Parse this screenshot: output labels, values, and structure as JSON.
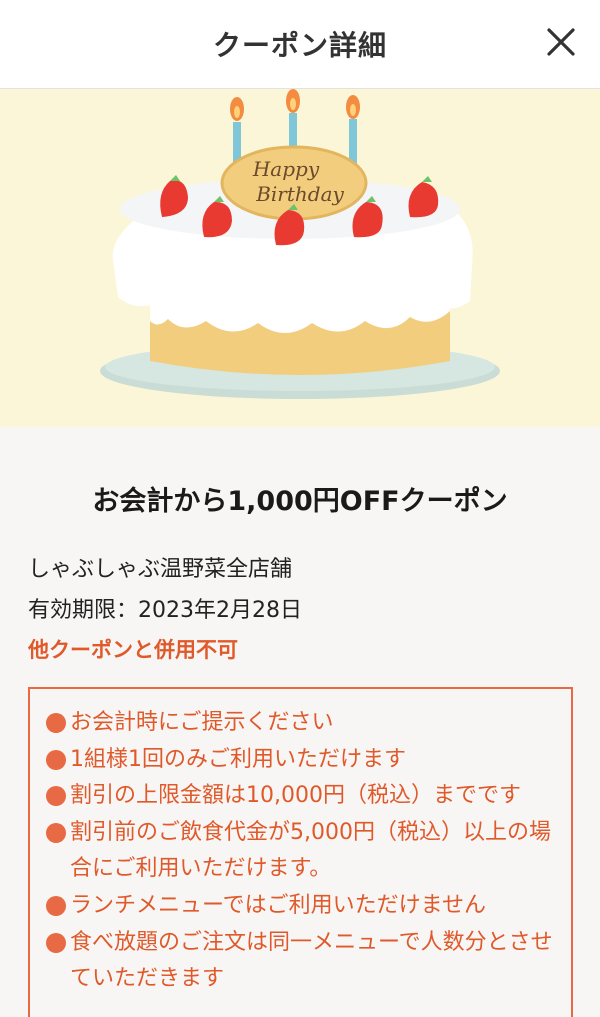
{
  "header": {
    "title": "クーポン詳細"
  },
  "hero": {
    "plaque_line1": "Happy",
    "plaque_line2": "Birthday",
    "icons": [
      "birthday-cake-illustration"
    ]
  },
  "coupon": {
    "title": "お会計から1,000円OFFクーポン",
    "store": "しゃぶしゃぶ温野菜全店舗",
    "expiry": "有効期限：2023年2月28日",
    "warning": "他クーポンと併用不可",
    "notes": [
      "お会計時にご提示ください",
      "1組様1回のみご利用いただけます",
      "割引の上限金額は10,000円（税込）までです",
      "割引前のご飲食代金が5,000円（税込）以上の場合にご利用いただけます。",
      "ランチメニューではご利用いただけません",
      "食べ放題のご注文は同一メニューで人数分とさせていただきます"
    ]
  },
  "colors": {
    "accent": "#e0592a",
    "hero_bg": "#fbf6d8",
    "page_bg": "#f7f6f4"
  }
}
